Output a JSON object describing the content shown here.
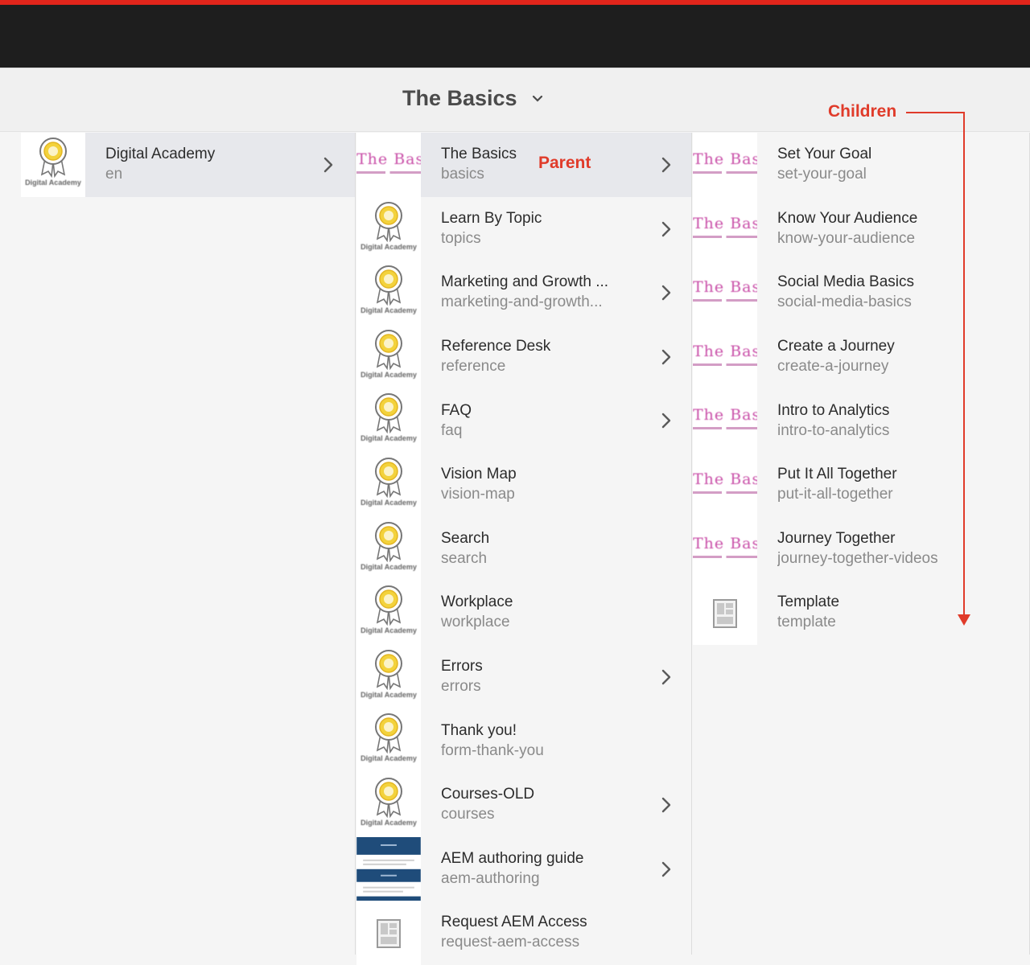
{
  "header": {
    "title": "The Basics"
  },
  "annotations": {
    "parent": "Parent",
    "children": "Children"
  },
  "column1": {
    "items": [
      {
        "title": "Digital Academy",
        "name": "en",
        "thumb": "badge",
        "thumb_label": "Digital Academy",
        "has_children": true,
        "selected": true
      }
    ]
  },
  "column2": {
    "items": [
      {
        "title": "The Basics",
        "name": "basics",
        "thumb": "pink",
        "has_children": true,
        "selected": true
      },
      {
        "title": "Learn By Topic",
        "name": "topics",
        "thumb": "badge",
        "has_children": true
      },
      {
        "title": "Marketing and Growth ...",
        "name": "marketing-and-growth...",
        "thumb": "badge",
        "has_children": true
      },
      {
        "title": "Reference Desk",
        "name": "reference",
        "thumb": "badge",
        "has_children": true
      },
      {
        "title": "FAQ",
        "name": "faq",
        "thumb": "badge",
        "has_children": true
      },
      {
        "title": "Vision Map",
        "name": "vision-map",
        "thumb": "badge",
        "has_children": false
      },
      {
        "title": "Search",
        "name": "search",
        "thumb": "badge",
        "has_children": false
      },
      {
        "title": "Workplace",
        "name": "workplace",
        "thumb": "badge",
        "has_children": false
      },
      {
        "title": "Errors",
        "name": "errors",
        "thumb": "badge",
        "has_children": true
      },
      {
        "title": "Thank you!",
        "name": "form-thank-you",
        "thumb": "badge",
        "has_children": false
      },
      {
        "title": "Courses-OLD",
        "name": "courses",
        "thumb": "badge",
        "has_children": true
      },
      {
        "title": "AEM authoring guide",
        "name": "aem-authoring",
        "thumb": "aem",
        "has_children": true
      },
      {
        "title": "Request AEM Access",
        "name": "request-aem-access",
        "thumb": "template",
        "has_children": false
      }
    ]
  },
  "column3": {
    "items": [
      {
        "title": "Set Your Goal",
        "name": "set-your-goal",
        "thumb": "pink"
      },
      {
        "title": "Know Your Audience",
        "name": "know-your-audience",
        "thumb": "pink"
      },
      {
        "title": "Social Media Basics",
        "name": "social-media-basics",
        "thumb": "pink"
      },
      {
        "title": "Create a Journey",
        "name": "create-a-journey",
        "thumb": "pink"
      },
      {
        "title": "Intro to Analytics",
        "name": "intro-to-analytics",
        "thumb": "pink"
      },
      {
        "title": "Put It All Together",
        "name": "put-it-all-together",
        "thumb": "pink"
      },
      {
        "title": "Journey Together",
        "name": "journey-together-videos",
        "thumb": "pink"
      },
      {
        "title": "Template",
        "name": "template",
        "thumb": "template"
      }
    ]
  },
  "thumb_text": {
    "badge": "Digital Academy",
    "pink": "The Basics"
  },
  "colors": {
    "accent_red": "#e1251b",
    "annotation_red": "#e03b2a",
    "selected_row": "#e7e8ec",
    "pink_thumb": "#c94fa8"
  },
  "icons": {
    "title_dropdown": "chevron-down-icon",
    "row_children": "chevron-right-icon",
    "template_thumb": "page-template-icon",
    "badge_thumb": "award-badge-icon"
  }
}
